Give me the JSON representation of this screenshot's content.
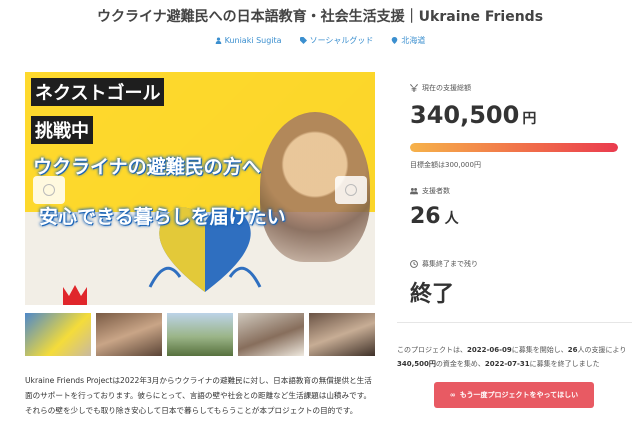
{
  "page": {
    "title": "ウクライナ避難民への日本語教育・社会生活支援｜Ukraine Friends"
  },
  "meta": {
    "author": "Kuniaki Sugita",
    "category": "ソーシャルグッド",
    "location": "北海道"
  },
  "hero": {
    "caption_1": "ネクストゴール",
    "caption_2": "挑戦中",
    "caption_3": "ウクライナの避難民の方へ",
    "caption_4": "安心できる暮らしを届けたい"
  },
  "thumbnails": [
    "thumbnail-1",
    "thumbnail-2",
    "thumbnail-3",
    "thumbnail-4",
    "thumbnail-5"
  ],
  "description": "Ukraine Friends Projectは2022年3月からウクライナの避難民に対し、日本語教育の無償提供と生活面のサポートを行っております。彼らにとって、言語の壁や社会との距離など生活課題は山積みです。それらの壁を少しでも取り除き安心して日本で暮らしてもらうことが本プロジェクトの目的です。",
  "funding": {
    "amount_label": "現在の支援総額",
    "amount": "340,500",
    "amount_unit": "円",
    "progress_fraction": 1.0,
    "goal_text": "目標金額は300,000円",
    "supporters_label": "支援者数",
    "supporters": "26",
    "supporters_unit": "人",
    "remaining_label": "募集終了まで残り",
    "status": "終了"
  },
  "summary": {
    "prefix": "このプロジェクトは、",
    "start_date": "2022-06-09",
    "middle_1": "に募集を開始し、",
    "count": "26",
    "middle_2": "人の支援により",
    "total": "340,500円",
    "middle_3": "の資金を集め、",
    "end_date": "2022-07-31",
    "suffix": "に募集を終了しました"
  },
  "cta": {
    "label": "もう一度プロジェクトをやってほしい"
  },
  "colors": {
    "accent_blue": "#3b8fcf",
    "cta_red": "#e85a63"
  },
  "icons": {
    "author": "person-icon",
    "category": "tag-icon",
    "location": "pin-icon",
    "amount": "yen-icon",
    "supporters": "people-icon",
    "remaining": "clock-icon",
    "cta": "infinity-icon"
  }
}
